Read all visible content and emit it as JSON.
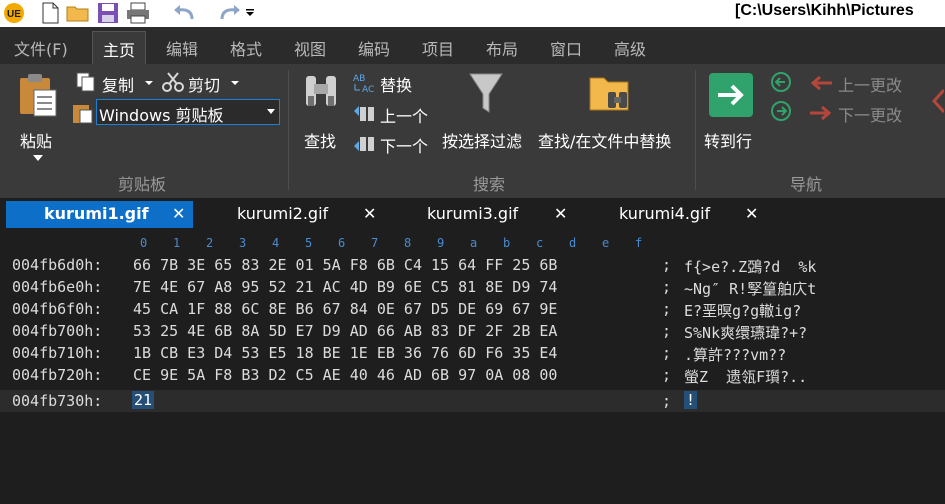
{
  "titlebar": {
    "app_icon": "UE",
    "window_title": "[C:\\Users\\Kihh\\Pictures",
    "quick_access": [
      "new-file-icon",
      "open-folder-icon",
      "save-icon",
      "print-icon",
      "undo-icon",
      "redo-icon",
      "dropdown-icon"
    ]
  },
  "menu": {
    "items": [
      "文件(F)",
      "主页",
      "编辑",
      "格式",
      "视图",
      "编码",
      "项目",
      "布局",
      "窗口",
      "高级"
    ],
    "active": "主页"
  },
  "ribbon": {
    "paste_label": "粘贴",
    "copy_label": "复制",
    "cut_label": "剪切",
    "clipboard_select": "Windows 剪贴板",
    "clipboard_group": "剪贴板",
    "find_label": "查找",
    "replace_label": "替换",
    "prev_label": "上一个",
    "next_label": "下一个",
    "filter_label": "按选择过滤",
    "find_in_files_label": "查找/在文件中替换",
    "search_group": "搜索",
    "goto_label": "转到行",
    "prev_change_label": "上一更改",
    "next_change_label": "下一更改",
    "nav_group": "导航"
  },
  "tabs": [
    {
      "name": "kurumi1.gif",
      "close": "✕",
      "active": true
    },
    {
      "name": "kurumi2.gif",
      "close": "✕",
      "active": false
    },
    {
      "name": "kurumi3.gif",
      "close": "✕",
      "active": false
    },
    {
      "name": "kurumi4.gif",
      "close": "✕",
      "active": false
    }
  ],
  "hex": {
    "ruler": [
      "0",
      "1",
      "2",
      "3",
      "4",
      "5",
      "6",
      "7",
      "8",
      "9",
      "a",
      "b",
      "c",
      "d",
      "e",
      "f"
    ],
    "rows": [
      {
        "addr": "004fb6d0h:",
        "bytes": "66 7B 3E 65 83 2E 01 5A F8 6B C4 15 64 FF 25 6B",
        "sep": ";",
        "ascii": "f{>e?.Z鵶?d  %k"
      },
      {
        "addr": "004fb6e0h:",
        "bytes": "7E 4E 67 A8 95 52 21 AC 4D B9 6E C5 81 8E D9 74",
        "sep": ";",
        "ascii": "~Ng″ R!孯篁舶庂t"
      },
      {
        "addr": "004fb6f0h:",
        "bytes": "45 CA 1F 88 6C 8E B6 67 84 0E 67 D5 DE 69 67 9E",
        "sep": ";",
        "ascii": "E?垩暝g?g轍ig?"
      },
      {
        "addr": "004fb700h:",
        "bytes": "53 25 4E 6B 8A 5D E7 D9 AD 66 AB 83 DF 2F 2B EA",
        "sep": ";",
        "ascii": "S%Nk爽缳瓙瑋?+?"
      },
      {
        "addr": "004fb710h:",
        "bytes": "1B CB E3 D4 53 E5 18 BE 1E EB 36 76 6D F6 35 E4",
        "sep": ";",
        "ascii": ".算許???vm??"
      },
      {
        "addr": "004fb720h:",
        "bytes": "CE 9E 5A F8 B3 D2 C5 AE 40 46 AD 6B 97 0A 08 00",
        "sep": ";",
        "ascii": "螢Z  遗瓴F瓆?.."
      },
      {
        "addr": "004fb730h:",
        "bytes": "21",
        "sep": ";",
        "ascii": "!"
      }
    ]
  },
  "colors": {
    "accent": "#0e6fc8",
    "goto_green": "#2fa36b",
    "ruler_blue": "#4a8bd0",
    "ribbon_bg": "#3a3a3a"
  }
}
